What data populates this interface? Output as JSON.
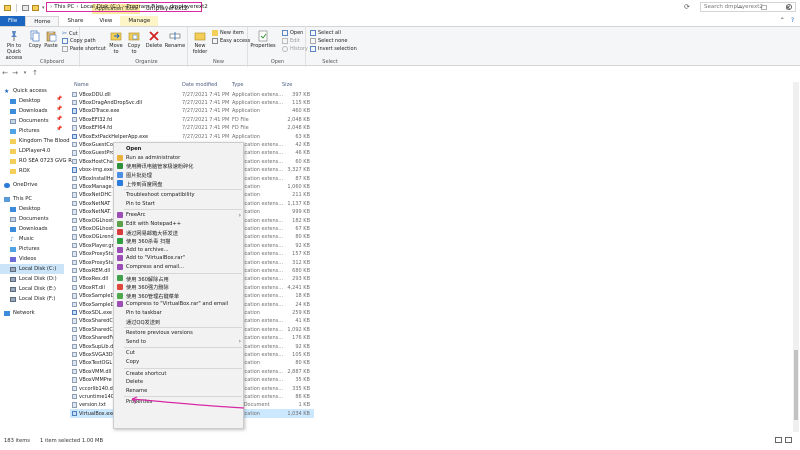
{
  "window": {
    "title": "dmplayerext2",
    "app_tools_label": "Application Tools",
    "minimize": "─",
    "maximize": "☐",
    "close": "✕"
  },
  "ribbon_tabs": [
    "File",
    "Home",
    "Share",
    "View",
    "Manage"
  ],
  "ribbon": {
    "clipboard": {
      "pin_label": "Pin to Quick access",
      "copy_label": "Copy",
      "paste_label": "Paste",
      "cut_label": "Cut",
      "copy_path_label": "Copy path",
      "paste_shortcut_label": "Paste shortcut",
      "group_label": "Clipboard"
    },
    "organize": {
      "move_to_label": "Move to",
      "copy_to_label": "Copy to",
      "delete_label": "Delete",
      "rename_label": "Rename",
      "group_label": "Organize"
    },
    "new": {
      "new_folder_label": "New folder",
      "new_item_label": "New item",
      "easy_access_label": "Easy access",
      "group_label": "New"
    },
    "open": {
      "properties_label": "Properties",
      "open_label": "Open",
      "edit_label": "Edit",
      "history_label": "History",
      "group_label": "Open"
    },
    "select": {
      "select_all_label": "Select all",
      "select_none_label": "Select none",
      "invert_label": "Invert selection",
      "group_label": "Select"
    }
  },
  "address": {
    "crumbs": [
      "This PC",
      "Local Disk (C:)",
      "Program Files",
      "dmplayerext2"
    ],
    "search_placeholder": "Search dmplayerext2"
  },
  "nav": {
    "items": [
      {
        "label": "Quick access",
        "icon": "star-icon"
      },
      {
        "label": "Desktop",
        "icon": "desktop-icon"
      },
      {
        "label": "Downloads",
        "icon": "download-icon"
      },
      {
        "label": "Documents",
        "icon": "documents-icon"
      },
      {
        "label": "Pictures",
        "icon": "pictures-icon"
      },
      {
        "label": "Kingdom The Blood",
        "icon": "folder-icon"
      },
      {
        "label": "LDPlayer4.0",
        "icon": "folder-icon"
      },
      {
        "label": "RO SEA 0723 GVG R",
        "icon": "folder-icon"
      },
      {
        "label": "ROX",
        "icon": "folder-icon"
      },
      {
        "label": "OneDrive",
        "icon": "cloud-icon"
      },
      {
        "label": "This PC",
        "icon": "pc-icon"
      },
      {
        "label": "Desktop",
        "icon": "desktop-icon"
      },
      {
        "label": "Documents",
        "icon": "documents-icon"
      },
      {
        "label": "Downloads",
        "icon": "download-icon"
      },
      {
        "label": "Music",
        "icon": "music-icon"
      },
      {
        "label": "Pictures",
        "icon": "pictures-icon"
      },
      {
        "label": "Videos",
        "icon": "videos-icon"
      },
      {
        "label": "Local Disk (C:)",
        "icon": "drive-icon"
      },
      {
        "label": "Local Disk (D:)",
        "icon": "drive-icon"
      },
      {
        "label": "Local Disk (E:)",
        "icon": "drive-icon"
      },
      {
        "label": "Local Disk (F:)",
        "icon": "drive-icon"
      },
      {
        "label": "Network",
        "icon": "network-icon"
      }
    ]
  },
  "columns": {
    "name": "Name",
    "date": "Date modified",
    "type": "Type",
    "size": "Size"
  },
  "files": [
    {
      "name": "VBoxDDU.dll",
      "date": "7/27/2021 7:41 PM",
      "type": "Application extens...",
      "size": "397 KB"
    },
    {
      "name": "VBoxDragAndDropSvc.dll",
      "date": "7/27/2021 7:41 PM",
      "type": "Application extens...",
      "size": "115 KB"
    },
    {
      "name": "VBoxDTrace.exe",
      "date": "7/27/2021 7:41 PM",
      "type": "Application",
      "size": "460 KB"
    },
    {
      "name": "VBoxEFI32.fd",
      "date": "7/27/2021 7:41 PM",
      "type": "FD File",
      "size": "2,048 KB"
    },
    {
      "name": "VBoxEFI64.fd",
      "date": "7/27/2021 7:41 PM",
      "type": "FD File",
      "size": "2,048 KB"
    },
    {
      "name": "VBoxExtPackHelperApp.exe",
      "date": "7/27/2021 7:41 PM",
      "type": "Application",
      "size": "63 KB"
    },
    {
      "name": "VBoxGuestCo",
      "date": "",
      "type": "Application extens...",
      "size": "42 KB"
    },
    {
      "name": "VBoxGuestPro",
      "date": "",
      "type": "Application extens...",
      "size": "46 KB"
    },
    {
      "name": "VBoxHostCha",
      "date": "",
      "type": "Application extens...",
      "size": "60 KB"
    },
    {
      "name": "vbox-img.exe",
      "date": "",
      "type": "Application extens...",
      "size": "3,327 KB"
    },
    {
      "name": "VBoxInstallHe",
      "date": "",
      "type": "Application extens...",
      "size": "87 KB"
    },
    {
      "name": "VBoxManage.",
      "date": "",
      "type": "Application",
      "size": "1,060 KB"
    },
    {
      "name": "VBoxNetDHC",
      "date": "",
      "type": "Application",
      "size": "211 KB"
    },
    {
      "name": "VBoxNetNAT",
      "date": "",
      "type": "Application extens...",
      "size": "1,137 KB"
    },
    {
      "name": "VBoxNetNAT.",
      "date": "",
      "type": "Application",
      "size": "999 KB"
    },
    {
      "name": "VBoxOGLhost",
      "date": "",
      "type": "Application extens...",
      "size": "182 KB"
    },
    {
      "name": "VBoxOGLhost",
      "date": "",
      "type": "Application extens...",
      "size": "67 KB"
    },
    {
      "name": "VBoxOGLrend",
      "date": "",
      "type": "Application extens...",
      "size": "80 KB"
    },
    {
      "name": "VBoxPlayer.gra",
      "date": "",
      "type": "Application extens...",
      "size": "92 KB"
    },
    {
      "name": "VBoxProxyStu",
      "date": "",
      "type": "Application extens...",
      "size": "157 KB"
    },
    {
      "name": "VBoxProxyStu",
      "date": "",
      "type": "Application extens...",
      "size": "312 KB"
    },
    {
      "name": "VBoxREM.dll",
      "date": "",
      "type": "Application extens...",
      "size": "680 KB"
    },
    {
      "name": "VBoxRes.dll",
      "date": "",
      "type": "Application extens...",
      "size": "293 KB"
    },
    {
      "name": "VBoxRT.dll",
      "date": "",
      "type": "Application extens...",
      "size": "4,241 KB"
    },
    {
      "name": "VBoxSampleD",
      "date": "",
      "type": "Application extens...",
      "size": "18 KB"
    },
    {
      "name": "VBoxSampleD",
      "date": "",
      "type": "Application extens...",
      "size": "24 KB"
    },
    {
      "name": "VBoxSDL.exe",
      "date": "",
      "type": "Application",
      "size": "259 KB"
    },
    {
      "name": "VBoxSharedC",
      "date": "",
      "type": "Application extens...",
      "size": "41 KB"
    },
    {
      "name": "VBoxSharedC",
      "date": "",
      "type": "Application extens...",
      "size": "1,092 KB"
    },
    {
      "name": "VBoxSharedFo",
      "date": "",
      "type": "Application extens...",
      "size": "176 KB"
    },
    {
      "name": "VBoxSupLib.d",
      "date": "",
      "type": "Application extens...",
      "size": "92 KB"
    },
    {
      "name": "VBoxSVGA3D.",
      "date": "",
      "type": "Application extens...",
      "size": "105 KB"
    },
    {
      "name": "VBoxTestOGL",
      "date": "",
      "type": "Application",
      "size": "80 KB"
    },
    {
      "name": "VBoxVMM.dll",
      "date": "",
      "type": "Application extens...",
      "size": "2,887 KB"
    },
    {
      "name": "VBoxVMMPre",
      "date": "",
      "type": "Application extens...",
      "size": "35 KB"
    },
    {
      "name": "vccorlib140.d",
      "date": "",
      "type": "Application extens...",
      "size": "335 KB"
    },
    {
      "name": "vcruntime140",
      "date": "",
      "type": "Application extens...",
      "size": "86 KB"
    },
    {
      "name": "version.txt",
      "date": "",
      "type": "Text Document",
      "size": "1 KB"
    },
    {
      "name": "VirtualBox.exe",
      "date": "7/27/2021 7:41 PM",
      "type": "Application",
      "size": "1,034 KB",
      "selected": true
    }
  ],
  "context_menu": {
    "items": [
      {
        "label": "Open",
        "icon": "",
        "bold": true
      },
      {
        "label": "Run as administrator",
        "icon": "shield-icon"
      },
      {
        "label": "使用腾讯电脑管家极速粉碎化",
        "icon": "tencent-icon"
      },
      {
        "label": "图片批处理",
        "icon": "image-icon"
      },
      {
        "label": "上传到百度网盘",
        "icon": "cloud-upload-icon"
      },
      {
        "label": "Troubleshoot compatibility",
        "icon": ""
      },
      {
        "label": "Pin to Start",
        "icon": ""
      },
      {
        "label": "FreeArc",
        "icon": "archive-icon",
        "submenu": true
      },
      {
        "label": "Edit with Notepad++",
        "icon": "notepad-icon"
      },
      {
        "label": "通过网易邮箱大师发送",
        "icon": "mail-icon"
      },
      {
        "label": "使用 360杀毒 扫描",
        "icon": "antivirus-icon"
      },
      {
        "label": "Add to archive...",
        "icon": "archive-icon"
      },
      {
        "label": "Add to \"VirtualBox.rar\"",
        "icon": "archive-icon"
      },
      {
        "label": "Compress and email...",
        "icon": "archive-icon"
      },
      {
        "label": "使用 360解除占用",
        "icon": "unlock-icon"
      },
      {
        "label": "使用 360强力删除",
        "icon": "delete-icon"
      },
      {
        "label": "使用 360管理右键菜单",
        "icon": "menu-icon"
      },
      {
        "label": "Compress to \"VirtualBox.rar\" and email",
        "icon": "archive-icon"
      },
      {
        "label": "Pin to taskbar",
        "icon": ""
      },
      {
        "label": "通过QQ发送到",
        "icon": ""
      },
      {
        "label": "Restore previous versions",
        "icon": ""
      },
      {
        "label": "Send to",
        "icon": "",
        "submenu": true
      },
      {
        "label": "Cut",
        "icon": ""
      },
      {
        "label": "Copy",
        "icon": ""
      },
      {
        "label": "Create shortcut",
        "icon": ""
      },
      {
        "label": "Delete",
        "icon": ""
      },
      {
        "label": "Rename",
        "icon": ""
      },
      {
        "label": "Properties",
        "icon": ""
      }
    ]
  },
  "status": {
    "count": "183 items",
    "selection": "1 item selected  1.00 MB"
  },
  "colors": {
    "accent": "#1a66c0",
    "selection": "#cce8ff",
    "annotation": "#d62aa5",
    "app_tools": "#fbe9a1"
  }
}
